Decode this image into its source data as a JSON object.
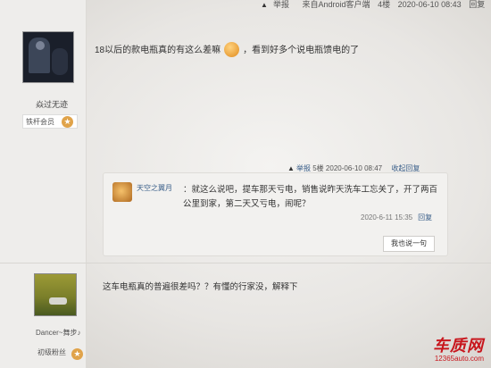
{
  "top_meta": {
    "report": "举报",
    "source": "来自Android客户端",
    "floor": "4楼",
    "time": "2020-06-10 08:43",
    "reply": "回复"
  },
  "post1": {
    "username": "焱过无迹",
    "badge": "铁杆会员",
    "text_before": "18以后的款电瓶真的有这么差嘛",
    "text_after": "，看到好多个说电瓶馈电的了"
  },
  "reply_meta": {
    "report": "举报",
    "floor": "5楼",
    "time": "2020-06-10 08:47",
    "collapse": "收起回复"
  },
  "reply": {
    "username": "天空之翼月",
    "text": "：就这么说吧，提车那天亏电，销售说昨天洗车工忘关了，开了两百公里到家，第二天又亏电，闹呢？",
    "time": "2020-6-11 15:35",
    "reply_link": "回复",
    "say_button": "我也说一句"
  },
  "post2": {
    "username": "Dancer~舞步♪",
    "badge": "初级粉丝",
    "text": "这车电瓶真的普遍很差吗？？有懂的行家没，解释下"
  },
  "watermark": {
    "title": "车质网",
    "url": "12365auto.com"
  }
}
